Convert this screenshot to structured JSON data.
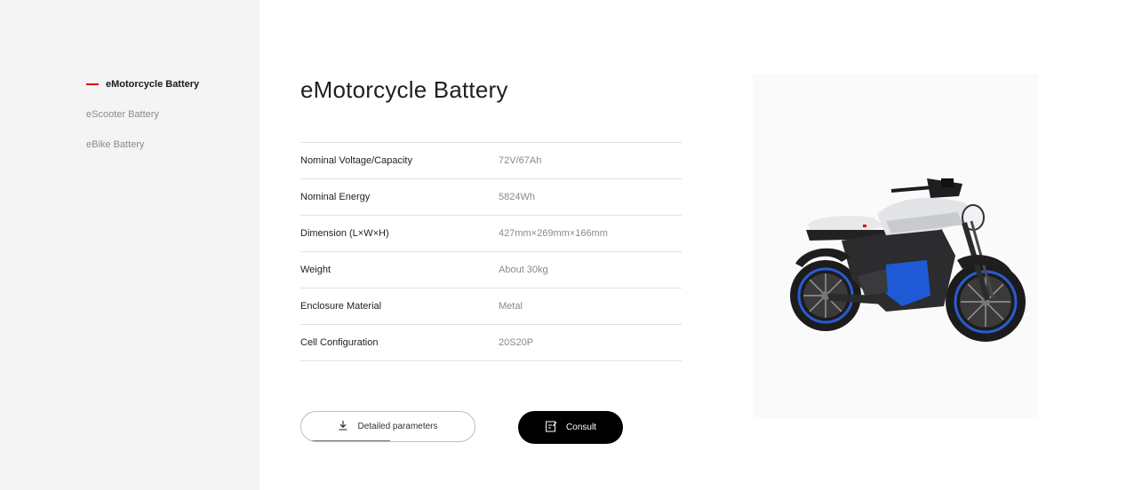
{
  "sidebar": {
    "items": [
      {
        "label": "eMotorcycle Battery",
        "active": true
      },
      {
        "label": "eScooter Battery",
        "active": false
      },
      {
        "label": "eBike Battery",
        "active": false
      }
    ]
  },
  "product": {
    "title": "eMotorcycle Battery",
    "specs": [
      {
        "label": "Nominal Voltage/Capacity",
        "value": "72V/67Ah"
      },
      {
        "label": "Nominal Energy",
        "value": "5824Wh"
      },
      {
        "label": "Dimension (L×W×H)",
        "value": "427mm×269mm×166mm"
      },
      {
        "label": "Weight",
        "value": "About 30kg"
      },
      {
        "label": "Enclosure Material",
        "value": "Metal"
      },
      {
        "label": "Cell Configuration",
        "value": "20S20P"
      }
    ]
  },
  "actions": {
    "download_label": "Detailed parameters",
    "consult_label": "Consult"
  },
  "icons": {
    "download": "download-icon",
    "consult": "edit-note-icon",
    "active_marker": "red-dash"
  },
  "colors": {
    "accent": "#d7000f",
    "sidebar_bg": "#f4f4f4",
    "button_dark": "#000000",
    "motorcycle_accent": "#1e5ad6"
  }
}
